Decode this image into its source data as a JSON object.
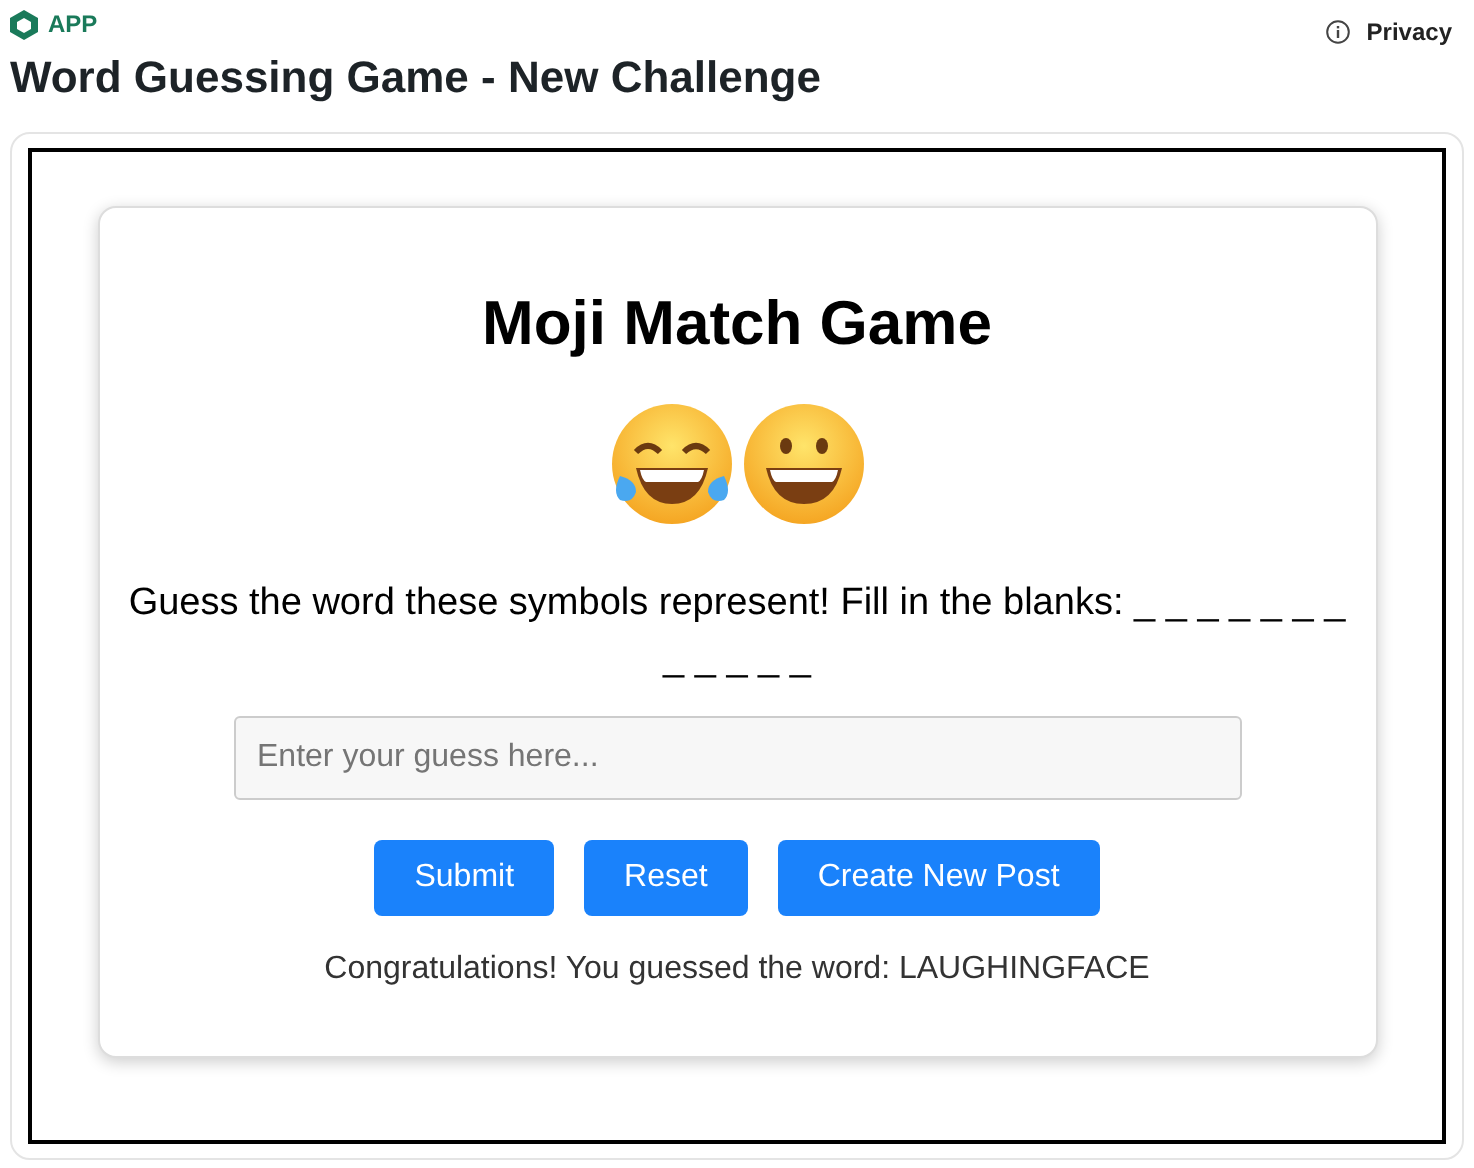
{
  "header": {
    "app_label": "APP",
    "privacy": "Privacy",
    "title": "Word Guessing Game - New Challenge"
  },
  "game": {
    "title": "Moji Match Game",
    "symbols": [
      {
        "kind": "laughing-tears"
      },
      {
        "kind": "grinning"
      }
    ],
    "prompt": "Guess the word these symbols represent! Fill in the blanks: _ _ _ _ _ _ _ _ _ _ _ _",
    "input": {
      "placeholder": "Enter your guess here..."
    },
    "buttons": [
      "Submit",
      "Reset",
      "Create New Post"
    ],
    "message": "Congratulations! You guessed the word: LAUGHINGFACE"
  }
}
